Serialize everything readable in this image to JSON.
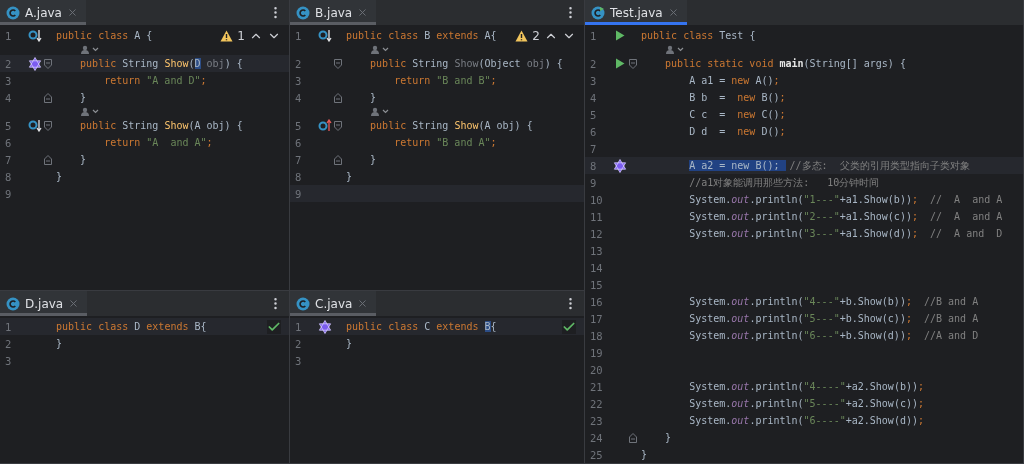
{
  "columns": [
    {
      "panes": [
        {
          "focused": false,
          "tab": {
            "label": "A.java",
            "selected": true
          },
          "inspection": {
            "kind": "warnings",
            "count": "1"
          },
          "lines": [
            {
              "kind": "code",
              "number": "1",
              "gutter": {
                "kind": "implemented"
              },
              "current": false,
              "tokens": [
                {
                  "kind": "keyword",
                  "text": "public class "
                },
                {
                  "kind": "plain",
                  "text": "A {"
                }
              ]
            },
            {
              "kind": "hint"
            },
            {
              "kind": "code",
              "number": "2",
              "gutter": {
                "kind": "assistant"
              },
              "fold": {
                "kind": "start"
              },
              "current": true,
              "tokens": [
                {
                  "kind": "keyword",
                  "text": "    public "
                },
                {
                  "kind": "plain",
                  "text": "String "
                },
                {
                  "kind": "declaration",
                  "text": "Show"
                },
                {
                  "kind": "plain",
                  "text": "("
                },
                {
                  "kind": "plain",
                  "text": "D",
                  "highlighted": true
                },
                {
                  "kind": "muted",
                  "text": " obj"
                },
                {
                  "kind": "plain",
                  "text": ") {"
                }
              ]
            },
            {
              "kind": "code",
              "number": "3",
              "current": false,
              "tokens": [
                {
                  "kind": "keyword",
                  "text": "        return "
                },
                {
                  "kind": "string",
                  "text": "\"A and D\""
                },
                {
                  "kind": "keyword",
                  "text": ";"
                }
              ]
            },
            {
              "kind": "code",
              "number": "4",
              "fold": {
                "kind": "end"
              },
              "current": false,
              "tokens": [
                {
                  "kind": "plain",
                  "text": "    }"
                }
              ]
            },
            {
              "kind": "hint"
            },
            {
              "kind": "code",
              "number": "5",
              "gutter": {
                "kind": "implemented"
              },
              "fold": {
                "kind": "start"
              },
              "current": false,
              "tokens": [
                {
                  "kind": "keyword",
                  "text": "    public "
                },
                {
                  "kind": "plain",
                  "text": "String "
                },
                {
                  "kind": "declaration",
                  "text": "Show"
                },
                {
                  "kind": "plain",
                  "text": "(A obj) {"
                }
              ]
            },
            {
              "kind": "code",
              "number": "6",
              "current": false,
              "tokens": [
                {
                  "kind": "keyword",
                  "text": "        return "
                },
                {
                  "kind": "string",
                  "text": "\"A  and A\""
                },
                {
                  "kind": "keyword",
                  "text": ";"
                }
              ]
            },
            {
              "kind": "code",
              "number": "7",
              "fold": {
                "kind": "end"
              },
              "current": false,
              "tokens": [
                {
                  "kind": "plain",
                  "text": "    }"
                }
              ]
            },
            {
              "kind": "code",
              "number": "8",
              "current": false,
              "tokens": [
                {
                  "kind": "plain",
                  "text": "}"
                }
              ]
            },
            {
              "kind": "code",
              "number": "9",
              "current": false
            }
          ]
        },
        {
          "focused": false,
          "tab": {
            "label": "D.java",
            "selected": true
          },
          "inspection": {
            "kind": "ok"
          },
          "lines": [
            {
              "kind": "code",
              "number": "1",
              "current": true,
              "tokens": [
                {
                  "kind": "keyword",
                  "text": "public class "
                },
                {
                  "kind": "plain",
                  "text": "D "
                },
                {
                  "kind": "keyword",
                  "text": "extends "
                },
                {
                  "kind": "plain",
                  "text": "B{"
                }
              ]
            },
            {
              "kind": "code",
              "number": "2",
              "current": false,
              "tokens": [
                {
                  "kind": "plain",
                  "text": "}"
                }
              ]
            },
            {
              "kind": "code",
              "number": "3",
              "current": false
            }
          ]
        }
      ]
    },
    {
      "panes": [
        {
          "focused": false,
          "tab": {
            "label": "B.java",
            "selected": true
          },
          "inspection": {
            "kind": "warnings",
            "count": "2"
          },
          "lines": [
            {
              "kind": "code",
              "number": "1",
              "gutter": {
                "kind": "implemented"
              },
              "current": false,
              "tokens": [
                {
                  "kind": "keyword",
                  "text": "public class "
                },
                {
                  "kind": "plain",
                  "text": "B "
                },
                {
                  "kind": "keyword",
                  "text": "extends "
                },
                {
                  "kind": "plain",
                  "text": "A{"
                }
              ]
            },
            {
              "kind": "hint"
            },
            {
              "kind": "code",
              "number": "2",
              "fold": {
                "kind": "start"
              },
              "current": false,
              "tokens": [
                {
                  "kind": "keyword",
                  "text": "    public "
                },
                {
                  "kind": "plain",
                  "text": "String "
                },
                {
                  "kind": "muted",
                  "text": "Show"
                },
                {
                  "kind": "plain",
                  "text": "(Object "
                },
                {
                  "kind": "muted",
                  "text": "obj"
                },
                {
                  "kind": "plain",
                  "text": ") {"
                }
              ]
            },
            {
              "kind": "code",
              "number": "3",
              "current": false,
              "tokens": [
                {
                  "kind": "keyword",
                  "text": "        return "
                },
                {
                  "kind": "string",
                  "text": "\"B and B\""
                },
                {
                  "kind": "keyword",
                  "text": ";"
                }
              ]
            },
            {
              "kind": "code",
              "number": "4",
              "fold": {
                "kind": "end"
              },
              "current": false,
              "tokens": [
                {
                  "kind": "plain",
                  "text": "    }"
                }
              ]
            },
            {
              "kind": "hint"
            },
            {
              "kind": "code",
              "number": "5",
              "gutter": {
                "kind": "overrides"
              },
              "fold": {
                "kind": "start"
              },
              "current": false,
              "tokens": [
                {
                  "kind": "keyword",
                  "text": "    public "
                },
                {
                  "kind": "plain",
                  "text": "String "
                },
                {
                  "kind": "declaration",
                  "text": "Show"
                },
                {
                  "kind": "plain",
                  "text": "(A obj) {"
                }
              ]
            },
            {
              "kind": "code",
              "number": "6",
              "current": false,
              "tokens": [
                {
                  "kind": "keyword",
                  "text": "        return "
                },
                {
                  "kind": "string",
                  "text": "\"B and A\""
                },
                {
                  "kind": "keyword",
                  "text": ";"
                }
              ]
            },
            {
              "kind": "code",
              "number": "7",
              "fold": {
                "kind": "end"
              },
              "current": false,
              "tokens": [
                {
                  "kind": "plain",
                  "text": "    }"
                }
              ]
            },
            {
              "kind": "code",
              "number": "8",
              "current": false,
              "tokens": [
                {
                  "kind": "plain",
                  "text": "}"
                }
              ]
            },
            {
              "kind": "code",
              "number": "9",
              "current": true
            }
          ]
        },
        {
          "focused": false,
          "tab": {
            "label": "C.java",
            "selected": true
          },
          "inspection": {
            "kind": "ok"
          },
          "lines": [
            {
              "kind": "code",
              "number": "1",
              "gutter": {
                "kind": "assistant"
              },
              "current": true,
              "tokens": [
                {
                  "kind": "keyword",
                  "text": "public class "
                },
                {
                  "kind": "plain",
                  "text": "C "
                },
                {
                  "kind": "keyword",
                  "text": "extends "
                },
                {
                  "kind": "plain",
                  "text": "B",
                  "highlighted": true
                },
                {
                  "kind": "plain",
                  "text": "{"
                }
              ]
            },
            {
              "kind": "code",
              "number": "2",
              "current": false,
              "tokens": [
                {
                  "kind": "plain",
                  "text": "}"
                }
              ]
            },
            {
              "kind": "code",
              "number": "3",
              "current": false
            }
          ]
        }
      ]
    },
    {
      "panes": [
        {
          "focused": true,
          "tab": {
            "label": "Test.java",
            "selected": true
          },
          "lines": [
            {
              "kind": "code",
              "number": "1",
              "gutter": {
                "kind": "run"
              },
              "current": false,
              "tokens": [
                {
                  "kind": "keyword",
                  "text": "public class "
                },
                {
                  "kind": "plain",
                  "text": "Test {"
                }
              ]
            },
            {
              "kind": "hint"
            },
            {
              "kind": "code",
              "number": "2",
              "gutter": {
                "kind": "run"
              },
              "fold": {
                "kind": "start"
              },
              "current": false,
              "tokens": [
                {
                  "kind": "keyword",
                  "text": "    public static void "
                },
                {
                  "kind": "entry",
                  "text": "main"
                },
                {
                  "kind": "plain",
                  "text": "(String[] args) {"
                }
              ]
            },
            {
              "kind": "code",
              "number": "3",
              "current": false,
              "tokens": [
                {
                  "kind": "plain",
                  "text": "        A a1 = "
                },
                {
                  "kind": "keyword",
                  "text": "new "
                },
                {
                  "kind": "plain",
                  "text": "A()"
                },
                {
                  "kind": "keyword",
                  "text": ";"
                }
              ]
            },
            {
              "kind": "code",
              "number": "4",
              "current": false,
              "tokens": [
                {
                  "kind": "plain",
                  "text": "        B b  =  "
                },
                {
                  "kind": "keyword",
                  "text": "new "
                },
                {
                  "kind": "plain",
                  "text": "B()"
                },
                {
                  "kind": "keyword",
                  "text": ";"
                }
              ]
            },
            {
              "kind": "code",
              "number": "5",
              "current": false,
              "tokens": [
                {
                  "kind": "plain",
                  "text": "        C c  =  "
                },
                {
                  "kind": "keyword",
                  "text": "new "
                },
                {
                  "kind": "plain",
                  "text": "C()"
                },
                {
                  "kind": "keyword",
                  "text": ";"
                }
              ]
            },
            {
              "kind": "code",
              "number": "6",
              "current": false,
              "tokens": [
                {
                  "kind": "plain",
                  "text": "        D d  =  "
                },
                {
                  "kind": "keyword",
                  "text": "new "
                },
                {
                  "kind": "plain",
                  "text": "D()"
                },
                {
                  "kind": "keyword",
                  "text": ";"
                }
              ]
            },
            {
              "kind": "code",
              "number": "7",
              "current": false
            },
            {
              "kind": "code",
              "number": "8",
              "gutter": {
                "kind": "assistant"
              },
              "current": true,
              "selected_text": "A a2 = new B(); ",
              "tokens": [
                {
                  "kind": "comment",
                  "text": "//多态:  父类的引用类型指向子类对象"
                }
              ]
            },
            {
              "kind": "code",
              "number": "9",
              "current": false,
              "tokens": [
                {
                  "kind": "comment",
                  "text": "        //a1对象能调用那些方法:   10分钟时间"
                }
              ]
            },
            {
              "kind": "code",
              "number": "10",
              "current": false,
              "tokens": [
                {
                  "kind": "plain",
                  "text": "        System."
                },
                {
                  "kind": "field",
                  "text": "out"
                },
                {
                  "kind": "plain",
                  "text": ".println("
                },
                {
                  "kind": "string",
                  "text": "\"1---\""
                },
                {
                  "kind": "plain",
                  "text": "+a1.Show(b))"
                },
                {
                  "kind": "keyword",
                  "text": ";"
                },
                {
                  "kind": "comment",
                  "text": "  //  A  and A"
                }
              ]
            },
            {
              "kind": "code",
              "number": "11",
              "current": false,
              "tokens": [
                {
                  "kind": "plain",
                  "text": "        System."
                },
                {
                  "kind": "field",
                  "text": "out"
                },
                {
                  "kind": "plain",
                  "text": ".println("
                },
                {
                  "kind": "string",
                  "text": "\"2---\""
                },
                {
                  "kind": "plain",
                  "text": "+a1.Show(c))"
                },
                {
                  "kind": "keyword",
                  "text": ";"
                },
                {
                  "kind": "comment",
                  "text": "  //  A  and A"
                }
              ]
            },
            {
              "kind": "code",
              "number": "12",
              "current": false,
              "tokens": [
                {
                  "kind": "plain",
                  "text": "        System."
                },
                {
                  "kind": "field",
                  "text": "out"
                },
                {
                  "kind": "plain",
                  "text": ".println("
                },
                {
                  "kind": "string",
                  "text": "\"3---\""
                },
                {
                  "kind": "plain",
                  "text": "+a1.Show(d))"
                },
                {
                  "kind": "keyword",
                  "text": ";"
                },
                {
                  "kind": "comment",
                  "text": "  //  A and  D"
                }
              ]
            },
            {
              "kind": "code",
              "number": "13",
              "current": false
            },
            {
              "kind": "code",
              "number": "14",
              "current": false
            },
            {
              "kind": "code",
              "number": "15",
              "current": false
            },
            {
              "kind": "code",
              "number": "16",
              "current": false,
              "tokens": [
                {
                  "kind": "plain",
                  "text": "        System."
                },
                {
                  "kind": "field",
                  "text": "out"
                },
                {
                  "kind": "plain",
                  "text": ".println("
                },
                {
                  "kind": "string",
                  "text": "\"4---\""
                },
                {
                  "kind": "plain",
                  "text": "+b.Show(b))"
                },
                {
                  "kind": "keyword",
                  "text": ";"
                },
                {
                  "kind": "comment",
                  "text": "  //B and A"
                }
              ]
            },
            {
              "kind": "code",
              "number": "17",
              "current": false,
              "tokens": [
                {
                  "kind": "plain",
                  "text": "        System."
                },
                {
                  "kind": "field",
                  "text": "out"
                },
                {
                  "kind": "plain",
                  "text": ".println("
                },
                {
                  "kind": "string",
                  "text": "\"5---\""
                },
                {
                  "kind": "plain",
                  "text": "+b.Show(c))"
                },
                {
                  "kind": "keyword",
                  "text": ";"
                },
                {
                  "kind": "comment",
                  "text": "  //B and A"
                }
              ]
            },
            {
              "kind": "code",
              "number": "18",
              "current": false,
              "tokens": [
                {
                  "kind": "plain",
                  "text": "        System."
                },
                {
                  "kind": "field",
                  "text": "out"
                },
                {
                  "kind": "plain",
                  "text": ".println("
                },
                {
                  "kind": "string",
                  "text": "\"6---\""
                },
                {
                  "kind": "plain",
                  "text": "+b.Show(d))"
                },
                {
                  "kind": "keyword",
                  "text": ";"
                },
                {
                  "kind": "comment",
                  "text": "  //A and D"
                }
              ]
            },
            {
              "kind": "code",
              "number": "19",
              "current": false
            },
            {
              "kind": "code",
              "number": "20",
              "current": false
            },
            {
              "kind": "code",
              "number": "21",
              "current": false,
              "tokens": [
                {
                  "kind": "plain",
                  "text": "        System."
                },
                {
                  "kind": "field",
                  "text": "out"
                },
                {
                  "kind": "plain",
                  "text": ".println("
                },
                {
                  "kind": "string",
                  "text": "\"4----\""
                },
                {
                  "kind": "plain",
                  "text": "+a2.Show(b))"
                },
                {
                  "kind": "keyword",
                  "text": ";"
                }
              ]
            },
            {
              "kind": "code",
              "number": "22",
              "current": false,
              "tokens": [
                {
                  "kind": "plain",
                  "text": "        System."
                },
                {
                  "kind": "field",
                  "text": "out"
                },
                {
                  "kind": "plain",
                  "text": ".println("
                },
                {
                  "kind": "string",
                  "text": "\"5----\""
                },
                {
                  "kind": "plain",
                  "text": "+a2.Show(c))"
                },
                {
                  "kind": "keyword",
                  "text": ";"
                }
              ]
            },
            {
              "kind": "code",
              "number": "23",
              "current": false,
              "tokens": [
                {
                  "kind": "plain",
                  "text": "        System."
                },
                {
                  "kind": "field",
                  "text": "out"
                },
                {
                  "kind": "plain",
                  "text": ".println("
                },
                {
                  "kind": "string",
                  "text": "\"6----\""
                },
                {
                  "kind": "plain",
                  "text": "+a2.Show(d))"
                },
                {
                  "kind": "keyword",
                  "text": ";"
                }
              ]
            },
            {
              "kind": "code",
              "number": "24",
              "fold": {
                "kind": "end"
              },
              "current": false,
              "tokens": [
                {
                  "kind": "plain",
                  "text": "    }"
                }
              ]
            },
            {
              "kind": "code",
              "number": "25",
              "current": false,
              "tokens": [
                {
                  "kind": "plain",
                  "text": "}"
                }
              ]
            }
          ]
        }
      ]
    }
  ]
}
